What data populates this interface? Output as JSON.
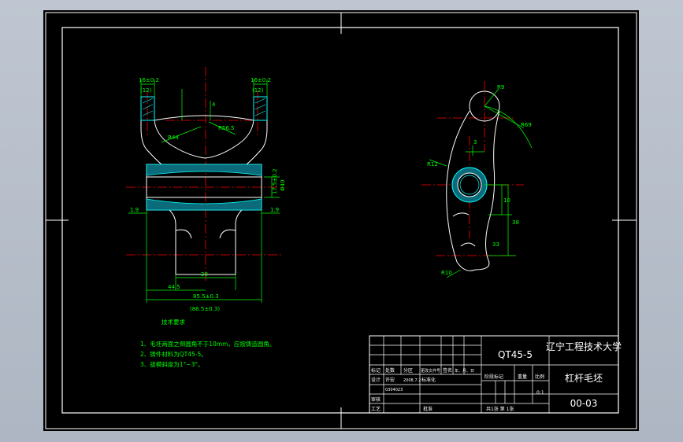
{
  "colors": {
    "background": "#000000",
    "frame": "#ffffff",
    "part_outline": "#ffffff",
    "dimension": "#00ff00",
    "centerline": "#ff0000",
    "section_hatch": "#00ffff",
    "viewport_bg": "#b8bfcb"
  },
  "front_view": {
    "dims": {
      "top_left": "16±0.2",
      "top_left_sub": "(12)",
      "top_right": "16±0.2",
      "top_right_sub": "(12)",
      "r44": "R44",
      "r56": "R56.5",
      "d_small": "4",
      "left_side": "1.9",
      "right_side": "1.9",
      "bore": "17.5±0.2",
      "bore_sub": "Φ40",
      "bottom_inner": "20",
      "bottom_left": "44.5",
      "bottom_total": "85.5±0.3",
      "bottom_sub": "(86.5±0.3)"
    }
  },
  "side_view": {
    "dims": {
      "r_top": "R9",
      "r_arc": "R69",
      "r_left": "R12",
      "d_hole": "3",
      "h1": "10",
      "v_long": "38",
      "v_short": "33",
      "r_bottom": "R10"
    }
  },
  "notes": {
    "heading": "技术要求",
    "lines": [
      "1、毛坯两面之倒圆角不于10mm，应按铸造圆角。",
      "2、铸件材料为QT45-5。",
      "3、拔模斜度为1°~3°。"
    ]
  },
  "title_block": {
    "material": "QT45-5",
    "school": "辽宁工程技术大学",
    "part_name": "杠杆毛坯",
    "drawing_no": "00-03",
    "rev_headers": [
      "标记",
      "处数",
      "分区",
      "更改文件号",
      "签名",
      "年、月、日"
    ],
    "designer_label": "设计",
    "designer_name": "许宏",
    "design_date": "2008.7.2",
    "standard_label": "标准化",
    "student_no": "0304023",
    "review_label": "审核",
    "process_label": "工艺",
    "approve_label": "批准",
    "stage_label": "阶段标记",
    "weight_label": "重量",
    "scale_label": "比例",
    "scale_value": "0:1",
    "sheet_info": "共1张   第   1张"
  }
}
